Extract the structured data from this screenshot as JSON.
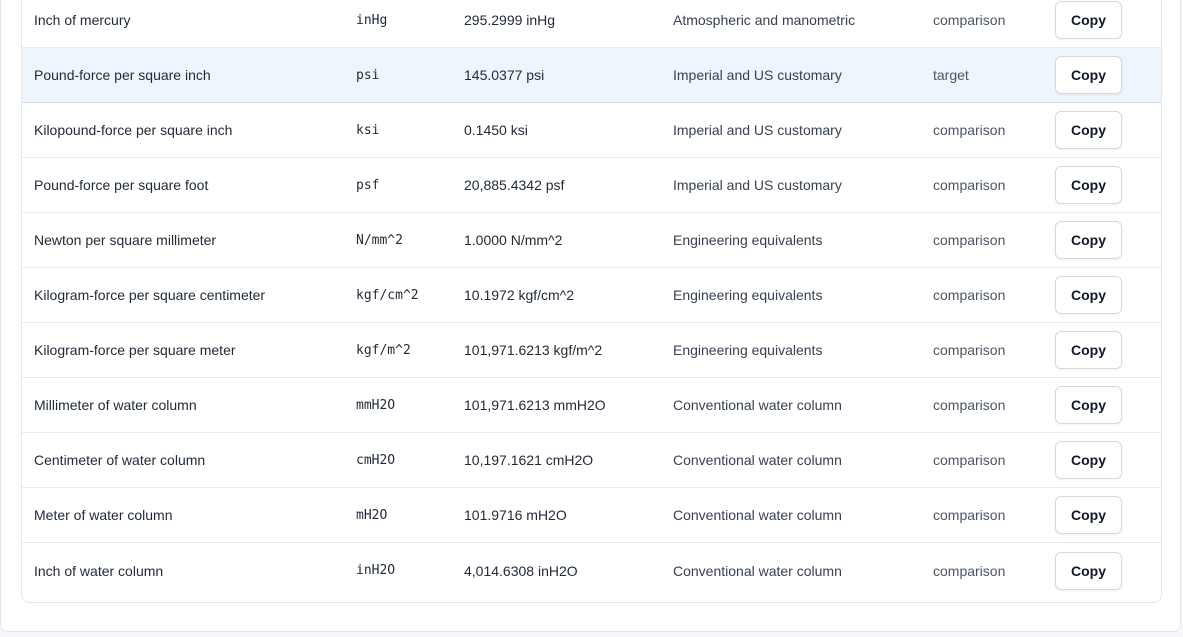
{
  "table": {
    "rows": [
      {
        "name": "Inch of mercury",
        "symbol": "inHg",
        "value": "295.2999 inHg",
        "group": "Atmospheric and manometric",
        "role": "comparison",
        "action": "Copy"
      },
      {
        "name": "Pound-force per square inch",
        "symbol": "psi",
        "value": "145.0377 psi",
        "group": "Imperial and US customary",
        "role": "target",
        "action": "Copy",
        "highlighted": true
      },
      {
        "name": "Kilopound-force per square inch",
        "symbol": "ksi",
        "value": "0.1450 ksi",
        "group": "Imperial and US customary",
        "role": "comparison",
        "action": "Copy"
      },
      {
        "name": "Pound-force per square foot",
        "symbol": "psf",
        "value": "20,885.4342 psf",
        "group": "Imperial and US customary",
        "role": "comparison",
        "action": "Copy"
      },
      {
        "name": "Newton per square millimeter",
        "symbol": "N/mm^2",
        "value": "1.0000 N/mm^2",
        "group": "Engineering equivalents",
        "role": "comparison",
        "action": "Copy"
      },
      {
        "name": "Kilogram-force per square centimeter",
        "symbol": "kgf/cm^2",
        "value": "10.1972 kgf/cm^2",
        "group": "Engineering equivalents",
        "role": "comparison",
        "action": "Copy"
      },
      {
        "name": "Kilogram-force per square meter",
        "symbol": "kgf/m^2",
        "value": "101,971.6213 kgf/m^2",
        "group": "Engineering equivalents",
        "role": "comparison",
        "action": "Copy"
      },
      {
        "name": "Millimeter of water column",
        "symbol": "mmH2O",
        "value": "101,971.6213 mmH2O",
        "group": "Conventional water column",
        "role": "comparison",
        "action": "Copy"
      },
      {
        "name": "Centimeter of water column",
        "symbol": "cmH2O",
        "value": "10,197.1621 cmH2O",
        "group": "Conventional water column",
        "role": "comparison",
        "action": "Copy"
      },
      {
        "name": "Meter of water column",
        "symbol": "mH2O",
        "value": "101.9716 mH2O",
        "group": "Conventional water column",
        "role": "comparison",
        "action": "Copy"
      },
      {
        "name": "Inch of water column",
        "symbol": "inH2O",
        "value": "4,014.6308 inH2O",
        "group": "Conventional water column",
        "role": "comparison",
        "action": "Copy"
      }
    ]
  },
  "colors": {
    "highlight_row": "#eef5fd",
    "border": "#e8eaee"
  }
}
